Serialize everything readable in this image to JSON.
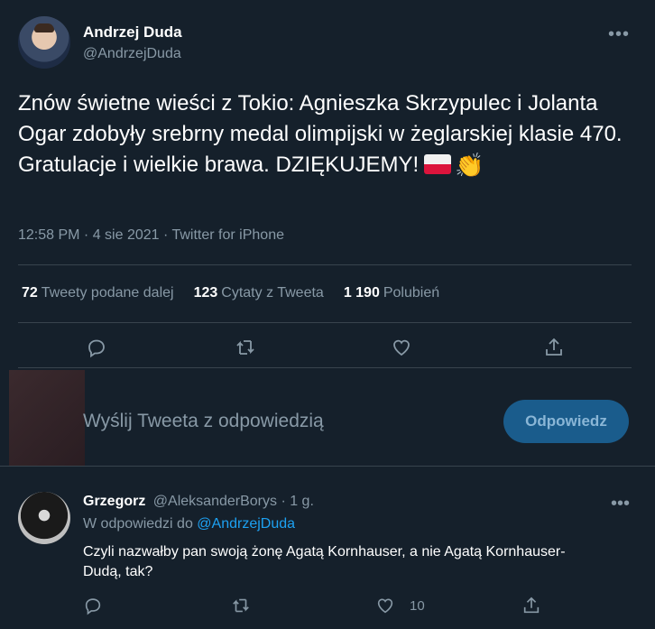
{
  "main_tweet": {
    "author_name": "Andrzej Duda",
    "author_handle": "@AndrzejDuda",
    "more_label": "•••",
    "text": "Znów świetne wieści z Tokio: Agnieszka Skrzypulec i Jolanta Ogar zdobyły srebrny medal olimpijski w żeglarskiej klasie 470. Gratulacje i wielkie brawa. DZIĘKUJEMY!",
    "emoji": [
      "flag-poland",
      "clapping-hands"
    ],
    "clap_glyph": "👏",
    "time": "12:58 PM",
    "date": "4 sie 2021",
    "source": "Twitter for iPhone",
    "separator": " · ",
    "stats": {
      "retweets_count": "72",
      "retweets_label": "Tweety podane dalej",
      "quotes_count": "123",
      "quotes_label": "Cytaty z Tweeta",
      "likes_count": "1 190",
      "likes_label": "Polubień"
    }
  },
  "reply_composer": {
    "placeholder": "Wyślij Tweeta z odpowiedzią",
    "button_label": "Odpowiedz"
  },
  "reply": {
    "author_name": "Grzegorz",
    "author_handle": "@AleksanderBorys",
    "time_ago": "· 1 g.",
    "more_label": "•••",
    "replying_to_prefix": "W odpowiedzi do",
    "replying_to_handle": "@AndrzejDuda",
    "text": "Czyli nazwałby pan swoją żonę Agatą Kornhauser, a nie Agatą Kornhauser-Dudą, tak?",
    "likes": "10"
  },
  "colors": {
    "background": "#15202b",
    "secondary_text": "#8899a6",
    "accent": "#1da1f2",
    "reply_button": "#1a5c8c"
  }
}
